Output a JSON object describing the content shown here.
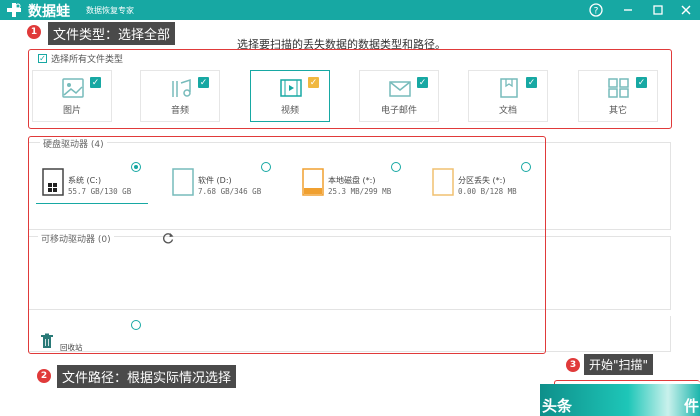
{
  "titlebar": {
    "app_name": "数据蛙",
    "app_subtitle": "数据恢复专家",
    "help_icon": "help-icon",
    "min_icon": "minimize-icon",
    "max_icon": "maximize-icon",
    "close_icon": "close-icon"
  },
  "callouts": [
    {
      "num": "1",
      "label": "文件类型：选择全部"
    },
    {
      "num": "2",
      "label": "文件路径：根据实际情况选择"
    },
    {
      "num": "3",
      "label": "开始\"扫描\""
    }
  ],
  "instruction": "选择要扫描的丢失数据的数据类型和路径。",
  "file_types": {
    "select_all_label": "选择所有文件类型",
    "items": [
      {
        "label": "图片",
        "icon": "image-icon",
        "checked": true
      },
      {
        "label": "音频",
        "icon": "music-icon",
        "checked": true
      },
      {
        "label": "视频",
        "icon": "video-icon",
        "checked": true,
        "selected": true
      },
      {
        "label": "电子邮件",
        "icon": "email-icon",
        "checked": true
      },
      {
        "label": "文档",
        "icon": "document-icon",
        "checked": true
      },
      {
        "label": "其它",
        "icon": "other-icon",
        "checked": true
      }
    ]
  },
  "drives": {
    "hard_title": "硬盘驱动器 (4)",
    "items": [
      {
        "name": "系统 (C:)",
        "size": "55.7 GB/130 GB",
        "icon": "windows-drive-icon",
        "selected": true
      },
      {
        "name": "软件 (D:)",
        "size": "7.68 GB/346 GB",
        "icon": "drive-icon",
        "selected": false
      },
      {
        "name": "本地磁盘 (*:)",
        "size": "25.3 MB/299 MB",
        "icon": "drive-orange-icon",
        "selected": false
      },
      {
        "name": "分区丢失 (*:)",
        "size": "0.00  B/128 MB",
        "icon": "drive-lost-icon",
        "selected": false
      }
    ],
    "removable_title": "可移动驱动器 (0)",
    "refresh_icon": "refresh-icon",
    "recycle_label": "回收站",
    "recycle_icon": "trash-icon"
  },
  "scan_button": {
    "text_left": "头条",
    "text_right": "件"
  },
  "colors": {
    "accent": "#17a8a3",
    "callout_red": "#e03a3a",
    "callout_label_bg": "#4a4a4a"
  }
}
